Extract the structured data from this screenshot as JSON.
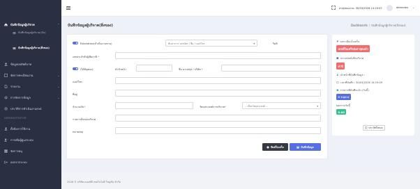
{
  "sidebar": {
    "groups": [
      {
        "label": "บันทึกข้อมูลผู้บริจาค",
        "icon": "home-icon",
        "active": true
      },
      {
        "label": "ข้อมูลผลลัพธ์บาท",
        "icon": "person-icon"
      },
      {
        "label": "จัดการทะเบียนงาน",
        "icon": "list-icon"
      },
      {
        "label": "รายงาน",
        "icon": "file-icon"
      },
      {
        "label": "การจัดการข้อมูล",
        "icon": "settings-icon"
      },
      {
        "label": "ประวัติการทำเนินงานสงฆ์",
        "icon": "history-icon"
      },
      {
        "label": "ตั้งข้อการใช้งาน",
        "icon": "user-icon"
      },
      {
        "label": "การเพิ่มผู้ดูแลระบบ",
        "icon": "user-plus-icon"
      },
      {
        "label": "จัดการผนุ",
        "icon": "grid-icon"
      },
      {
        "label": "ออกจากระบบ",
        "icon": "logout-icon"
      }
    ],
    "subitems": [
      {
        "label": "บันทึกข้อมูลผู้บริจาค(เงิน)"
      },
      {
        "label": "บันทึกข้อมูลผู้บริจาค(สิ่งของ)",
        "active": true
      }
    ],
    "admin_heading": "ADMINISTRATOR"
  },
  "topbar": {
    "datetime": "ล่าสุดของงาน: 30/03/2026 14:19:07",
    "username": "dearnden"
  },
  "page": {
    "title": "บันทึกข้อมูลผู้บริจาค(สิ่งของ)",
    "breadcrumb_root": "Dashboards",
    "breadcrumb_current": "บันทึกข้อมูลผู้บริจาค(สิ่งของ)"
  },
  "form": {
    "toggle1_label": "Estonation(ดำเนินงานทาน)",
    "search_placeholder": "ค้นหาจาก: เลขบัตร / ชื่อ / เบอร์โทร",
    "reference_label": "ริมทิ",
    "idcard_label": "เลขประจำตัวผู้เสียภาษี",
    "toggle2_label": "(ได้สัญชอง)",
    "prefix_label": "คำนำหน้า",
    "fullname_label": "ชื่อ นามสกุล / บริษัท",
    "phone_label": "เบอร์โทร",
    "address_label": "ที่อยู่",
    "quantity_label": "จำนวนเงิน",
    "purpose_label": "วัตถุประสงค์การบริจาค",
    "purpose_value": "-- เลือกวัตถุประสงค์ --",
    "detail_label": "รายการสิ่งของบริจาค",
    "note_label": "หมายเหตุ",
    "btn_preview": "พิมพ์ใบเสร็จ",
    "btn_save": "บันทึกข้อมูล"
  },
  "info": {
    "receipt_header": "ผลระเบียนใบเสร็จ",
    "receipt_badge": "เลขที่ใบเสร็จยังล่าสุดแล้ว",
    "book_header": "ประเภทหนังสือบริจาค",
    "book_badge": "ค่าปี",
    "staff_label": "เจ้าหน้าที่บันทึกข้อมูล :",
    "date_label": "เวลาที่บันทึก : 30/03/2026 14:19:09",
    "total_label": "รายการที่บันทึกแล้ว (วันนี้)",
    "total_badge": "0 รายการ",
    "amount_label": "ยอดรวมวันนี้",
    "amount_badge": "0.00",
    "history_btn": "ประวัติทั้งหมด"
  },
  "footer": {
    "text": "2026 © บริษัท ดอนท์ดี เทคโนโลยี โซลูชั่น จำกัด"
  },
  "colors": {
    "accent": "#556ee6",
    "sidebar": "#2a3042",
    "danger": "#f46a6a",
    "success": "#34c38f"
  }
}
